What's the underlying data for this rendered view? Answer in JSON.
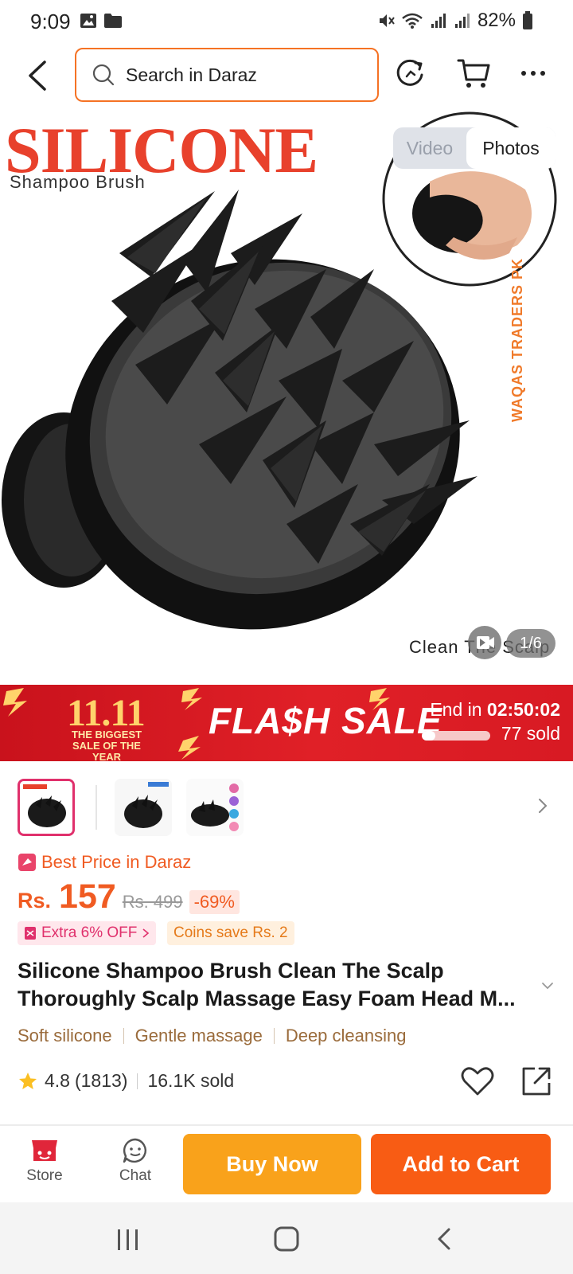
{
  "status_bar": {
    "time": "9:09",
    "battery": "82%"
  },
  "header": {
    "search_placeholder": "Search in Daraz"
  },
  "gallery": {
    "title_text": "SILICONE",
    "subtitle_text": "Shampoo Brush",
    "brand_watermark": "WAQAS TRADERS PK",
    "caption": "Clean The Scalp",
    "toggle": {
      "video": "Video",
      "photos": "Photos",
      "selected": "Photos"
    },
    "counter": "1/6"
  },
  "flash_sale": {
    "event_big": "11.11",
    "event_sub": "THE BIGGEST SALE OF THE YEAR",
    "title": "FLA$H SALE",
    "end_label": "End in",
    "timer": "02:50:02",
    "sold_text": "77 sold",
    "sold_progress": 0.2
  },
  "product": {
    "best_price_label": "Best Price in Daraz",
    "currency": "Rs.",
    "price": "157",
    "old_price": "Rs. 499",
    "discount": "-69%",
    "extra_off": "Extra 6% OFF",
    "coins": "Coins save Rs. 2",
    "title_line1": "Silicone Shampoo Brush Clean The Scalp",
    "title_line2": "Thoroughly Scalp Massage Easy Foam Head M...",
    "features": [
      "Soft silicone",
      "Gentle massage",
      "Deep cleansing"
    ],
    "rating": "4.8",
    "rating_count": "(1813)",
    "sold": "16.1K sold"
  },
  "action_bar": {
    "store_label": "Store",
    "chat_label": "Chat",
    "buy_now": "Buy Now",
    "add_to_cart": "Add to Cart"
  },
  "colors": {
    "brand_orange": "#f57224",
    "buy_now": "#f9a21b",
    "add_to_cart": "#f85c14",
    "flash_red": "#d81a23"
  }
}
